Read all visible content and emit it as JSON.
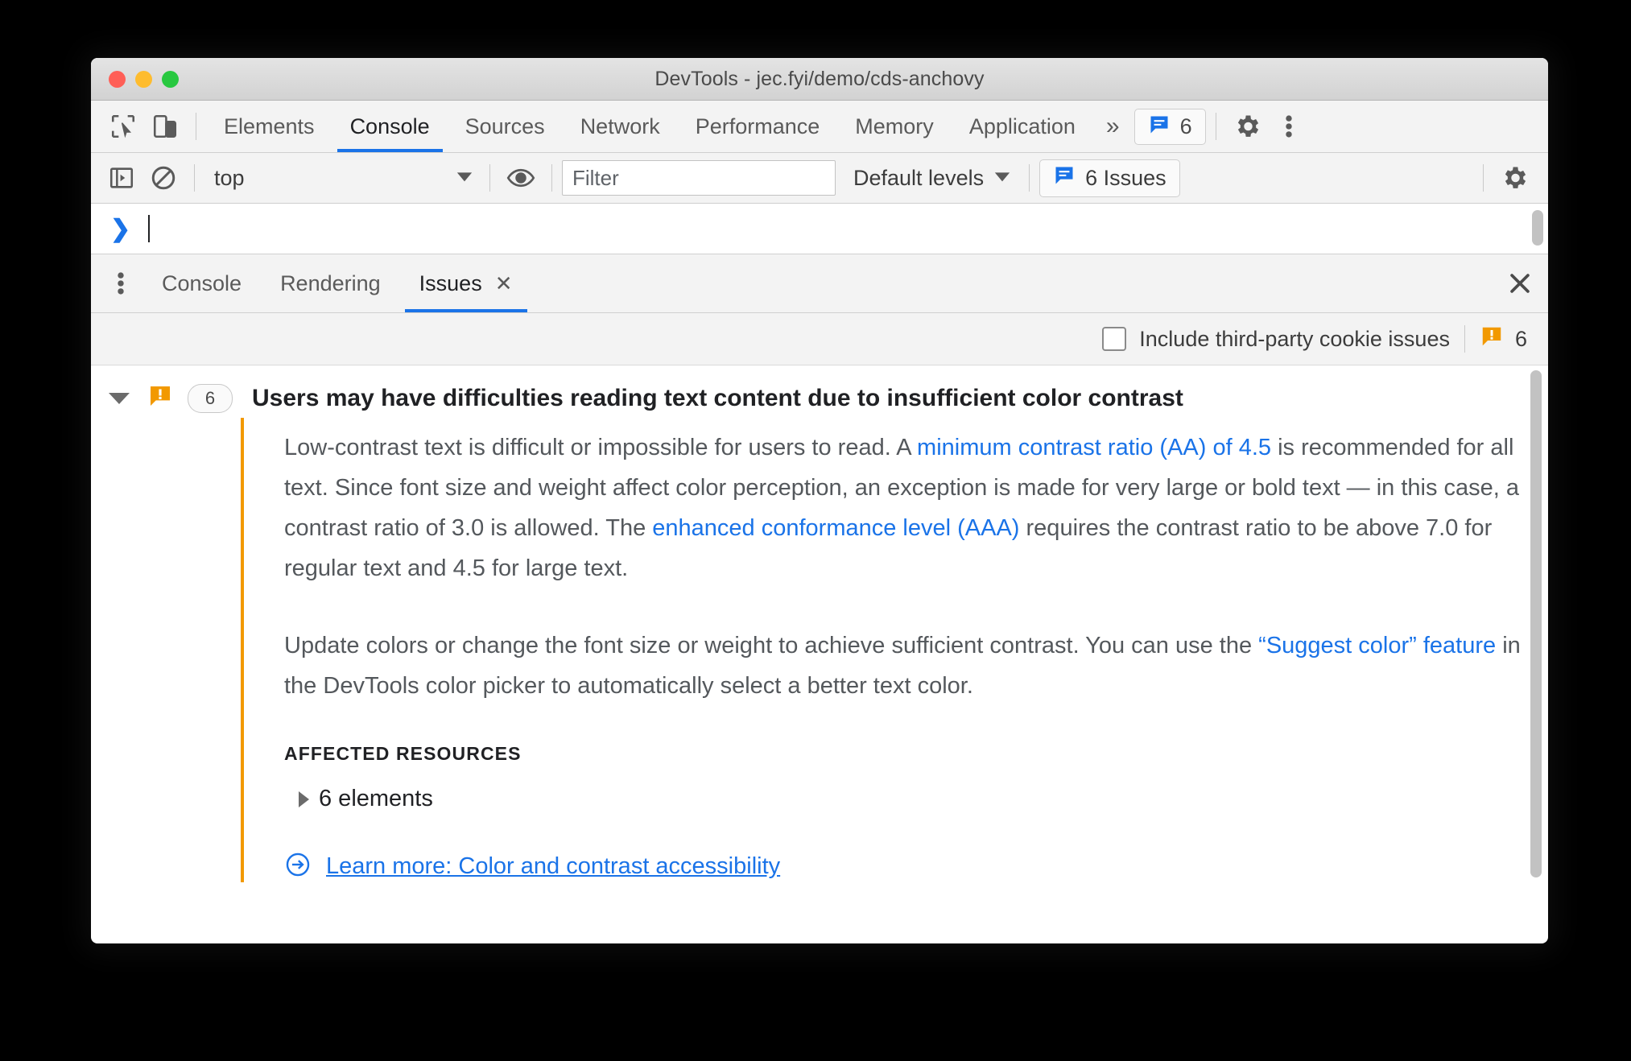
{
  "window": {
    "title": "DevTools - jec.fyi/demo/cds-anchovy",
    "traffic_lights": [
      "close",
      "minimize",
      "zoom"
    ]
  },
  "main_tabs": {
    "inspect_icon": "inspect-cursor-icon",
    "device_icon": "device-toolbar-icon",
    "items": [
      {
        "label": "Elements",
        "active": false
      },
      {
        "label": "Console",
        "active": true
      },
      {
        "label": "Sources",
        "active": false
      },
      {
        "label": "Network",
        "active": false
      },
      {
        "label": "Performance",
        "active": false
      },
      {
        "label": "Memory",
        "active": false
      },
      {
        "label": "Application",
        "active": false
      }
    ],
    "more_tabs": "»",
    "issues_badge": {
      "icon": "issue-message-icon",
      "count": "6"
    },
    "settings_icon": "gear-icon",
    "more_icon": "kebab-menu-icon"
  },
  "console_toolbar": {
    "sidebar_toggle_icon": "console-sidebar-icon",
    "clear_icon": "clear-console-icon",
    "context": {
      "value": "top",
      "caret": "▼"
    },
    "eye_icon": "live-expression-icon",
    "filter": {
      "value": "",
      "placeholder": "Filter"
    },
    "levels": {
      "label": "Default levels",
      "caret": "▼"
    },
    "issues_button": {
      "icon": "issue-message-icon",
      "label": "6 Issues"
    },
    "settings_icon": "gear-icon"
  },
  "console_prompt": {
    "chevron": "❯",
    "value": ""
  },
  "drawer_tabs": {
    "menu_icon": "kebab-menu-icon",
    "items": [
      {
        "label": "Console",
        "active": false,
        "closable": false
      },
      {
        "label": "Rendering",
        "active": false,
        "closable": false
      },
      {
        "label": "Issues",
        "active": true,
        "closable": true,
        "close_glyph": "✕"
      }
    ],
    "close_drawer_icon": "close-icon",
    "close_drawer_glyph": "✕"
  },
  "issues_filterbar": {
    "checkbox_label": "Include third-party cookie issues",
    "checkbox_checked": false,
    "warning_icon": "warning-message-icon",
    "warning_count": "6"
  },
  "issue": {
    "expand_glyph": "▼",
    "severity_icon": "warning-message-icon",
    "count_badge": "6",
    "title": "Users may have difficulties reading text content due to insufficient color contrast",
    "paragraph1": {
      "part1": "Low-contrast text is difficult or impossible for users to read. A ",
      "link1": "minimum contrast ratio (AA) of 4.5",
      "part2": " is recommended for all text. Since font size and weight affect color perception, an exception is made for very large or bold text — in this case, a contrast ratio of 3.0 is allowed. The ",
      "link2": "enhanced conformance level (AAA)",
      "part3": " requires the contrast ratio to be above 7.0 for regular text and 4.5 for large text."
    },
    "paragraph2": {
      "part1": "Update colors or change the font size or weight to achieve sufficient contrast. You can use the ",
      "link1": "“Suggest color” feature",
      "part2": " in the DevTools color picker to automatically select a better text color."
    },
    "affected_resources_label": "AFFECTED RESOURCES",
    "affected_resources_item": "6 elements",
    "learn_more_icon": "arrow-circle-icon",
    "learn_more_link": "Learn more: Color and contrast accessibility"
  },
  "colors": {
    "accent_blue": "#1a73e8",
    "warning_orange": "#f29900",
    "toolbar_bg": "#f3f3f3",
    "text_primary": "#202124",
    "text_secondary": "#54585c"
  }
}
